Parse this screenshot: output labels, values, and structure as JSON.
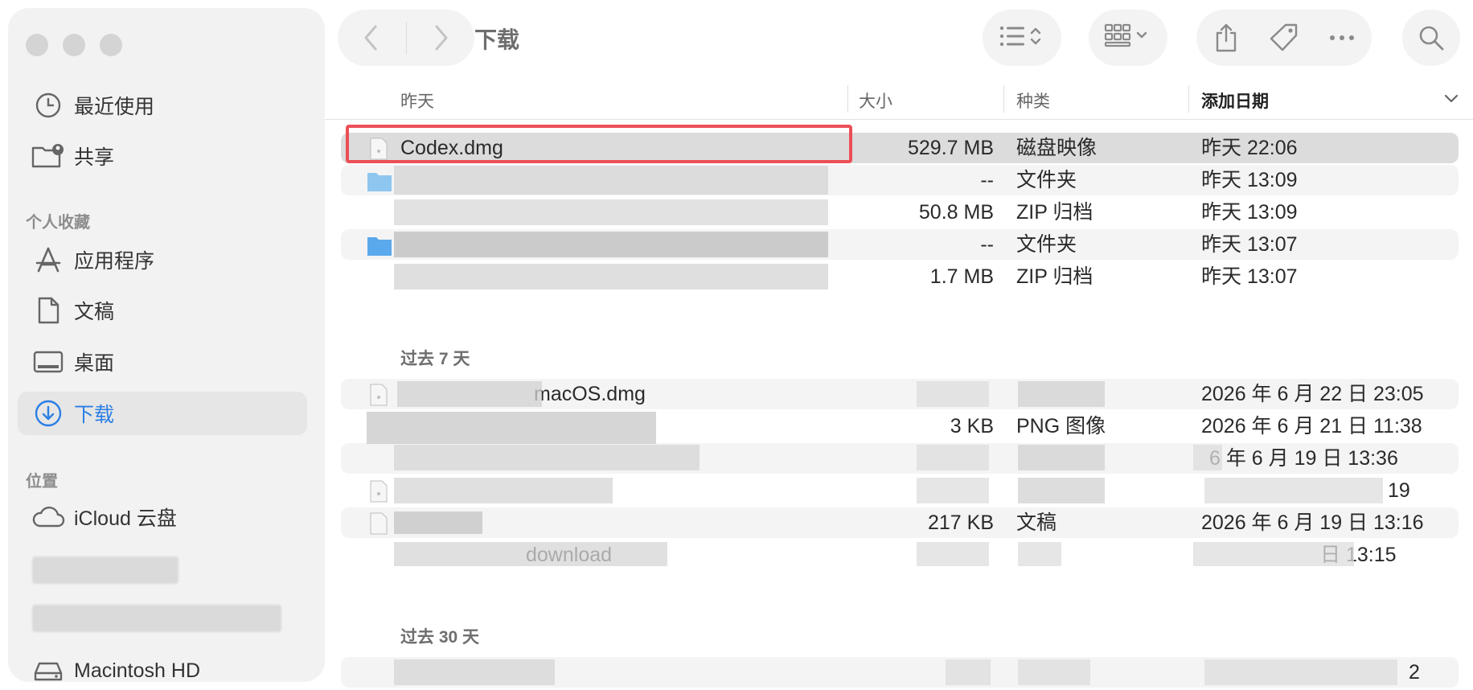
{
  "window": {
    "title": "下载"
  },
  "sidebar": {
    "items_top": [
      {
        "label": "最近使用",
        "icon": "clock-icon"
      },
      {
        "label": "共享",
        "icon": "shared-folder-icon"
      }
    ],
    "favorites_title": "个人收藏",
    "favorites": [
      {
        "label": "应用程序",
        "icon": "applications-icon"
      },
      {
        "label": "文稿",
        "icon": "document-icon"
      },
      {
        "label": "桌面",
        "icon": "desktop-icon"
      },
      {
        "label": "下载",
        "icon": "download-icon",
        "active": true
      }
    ],
    "locations_title": "位置",
    "locations": [
      {
        "label": "iCloud 云盘",
        "icon": "cloud-icon"
      },
      {
        "label": "Macintosh HD",
        "icon": "disk-icon"
      }
    ]
  },
  "columns": {
    "name": "昨天",
    "size": "大小",
    "kind": "种类",
    "date": "添加日期"
  },
  "groups": {
    "yesterday": "昨天",
    "past7": "过去 7 天",
    "past30": "过去 30 天"
  },
  "rows_yesterday": [
    {
      "name": "Codex.dmg",
      "size": "529.7 MB",
      "kind": "磁盘映像",
      "date": "昨天 22:06"
    },
    {
      "name": "",
      "size": "--",
      "kind": "文件夹",
      "date": "昨天 13:09"
    },
    {
      "name": "",
      "size": "50.8 MB",
      "kind": "ZIP 归档",
      "date": "昨天 13:09"
    },
    {
      "name": "",
      "size": "--",
      "kind": "文件夹",
      "date": "昨天 13:07"
    },
    {
      "name": "",
      "size": "1.7 MB",
      "kind": "ZIP 归档",
      "date": "昨天 13:07"
    }
  ],
  "rows_past7": [
    {
      "name": "macOS.dmg",
      "size": "",
      "kind": "",
      "date": "2026 年 6 月 22 日 23:05"
    },
    {
      "name": "",
      "size": "3 KB",
      "kind": "PNG 图像",
      "date": "2026 年 6 月 21 日 11:38"
    },
    {
      "name": "",
      "size": "",
      "kind": "",
      "date": "6 年 6 月 19 日 13:36"
    },
    {
      "name": "",
      "size": "",
      "kind": "",
      "date": "19"
    },
    {
      "name": "",
      "size": "217 KB",
      "kind": "文稿",
      "date": "2026 年 6 月 19 日 13:16"
    },
    {
      "name": "download",
      "size": "",
      "kind": "",
      "date": "日 13:15"
    }
  ],
  "rows_past30": [
    {
      "name": "",
      "size": "",
      "kind": "",
      "date": "2"
    }
  ],
  "colors": {
    "accent": "#2b7fe5",
    "highlight": "#ec4f56"
  }
}
